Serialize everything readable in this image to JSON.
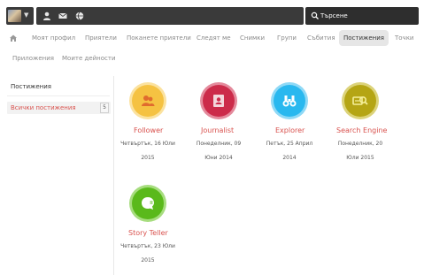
{
  "topbar": {
    "icons": [
      "avatar-photo",
      "caret-down-icon",
      "user-icon",
      "mail-icon",
      "globe-icon",
      "search-icon"
    ],
    "search_placeholder": "Търсене"
  },
  "tabs": {
    "home_icon": "home-icon",
    "items": [
      {
        "label": "Моят профил"
      },
      {
        "label": "Приятели"
      },
      {
        "label": "Поканете приятели"
      },
      {
        "label": "Следят ме"
      },
      {
        "label": "Снимки"
      },
      {
        "label": "Групи"
      },
      {
        "label": "Събития"
      },
      {
        "label": "Постижения",
        "active": true
      },
      {
        "label": "Точки"
      },
      {
        "label": "Приложения"
      },
      {
        "label": "Моите дейности"
      }
    ]
  },
  "sidebar": {
    "title": "Постижения",
    "items": [
      {
        "label": "Всички постижения",
        "count": "5"
      }
    ]
  },
  "badges": [
    {
      "name": "Follower",
      "date_line1": "Четвъртък, 16 Юли",
      "date_line2": "2015",
      "color": "#f5c242",
      "icon": "followers-icon"
    },
    {
      "name": "Journalist",
      "date_line1": "Понеделник, 09",
      "date_line2": "Юни 2014",
      "color": "#cc2b4a",
      "icon": "journal-icon"
    },
    {
      "name": "Explorer",
      "date_line1": "Петък, 25 Април",
      "date_line2": "2014",
      "color": "#29b8ef",
      "icon": "binoculars-icon"
    },
    {
      "name": "Search Engine",
      "date_line1": "Понеделник, 20",
      "date_line2": "Юли 2015",
      "color": "#b5a514",
      "icon": "search-engine-icon"
    },
    {
      "name": "Story Teller",
      "date_line1": "Четвъртък, 23 Юли",
      "date_line2": "2015",
      "color": "#5ab91b",
      "icon": "chat-bubble-icon"
    }
  ]
}
